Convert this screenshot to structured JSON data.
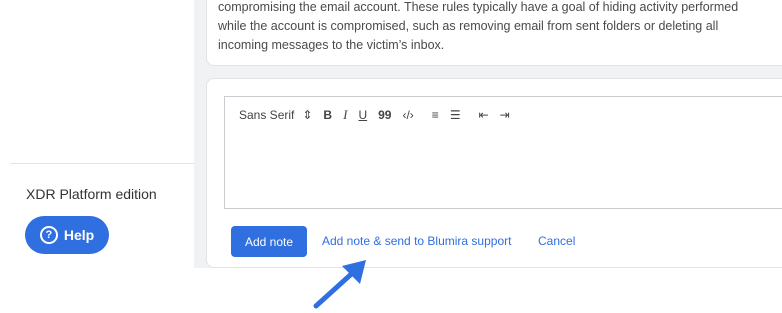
{
  "sidebar": {
    "edition_label": "XDR Platform edition",
    "help_label": "Help",
    "help_icon": "question-circle-icon"
  },
  "description": {
    "text": "compromising the email account. These rules typically have a goal of hiding activity performed while the account is compromised, such as removing email from sent folders or deleting all incoming messages to the victim’s inbox."
  },
  "editor": {
    "toolbar": {
      "font_select": "Sans Serif",
      "font_select_caret": "⇕",
      "bold": "B",
      "italic": "I",
      "underline": "U",
      "blockquote": "99",
      "code": "‹/›",
      "ordered_list": "≡",
      "bullet_list": "☰",
      "outdent": "⇤",
      "indent": "⇥"
    },
    "content": ""
  },
  "actions": {
    "add_note": "Add note",
    "add_note_send": "Add note & send to Blumira support",
    "cancel": "Cancel"
  },
  "colors": {
    "accent": "#2f6fe0",
    "background": "#f1f2f4",
    "annotation_arrow": "#2f6fe0"
  }
}
